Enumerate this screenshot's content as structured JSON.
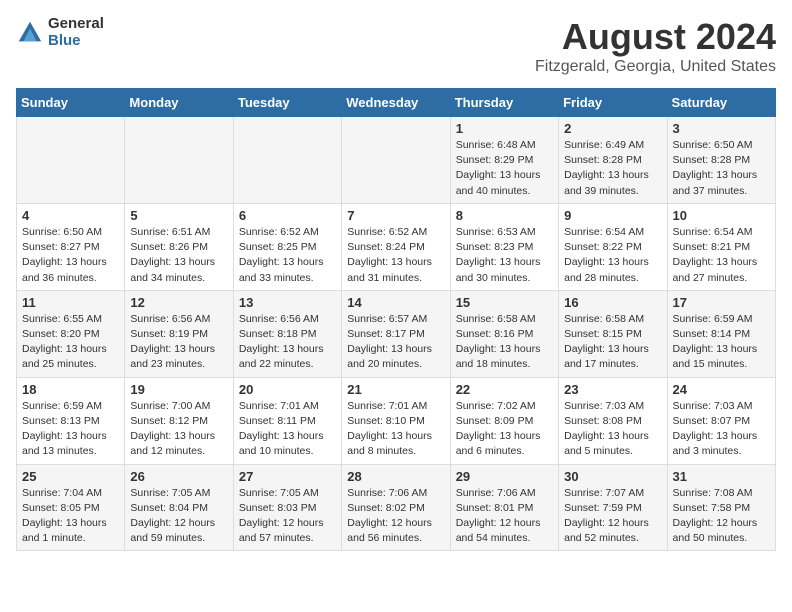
{
  "logo": {
    "general": "General",
    "blue": "Blue"
  },
  "title": "August 2024",
  "subtitle": "Fitzgerald, Georgia, United States",
  "days_of_week": [
    "Sunday",
    "Monday",
    "Tuesday",
    "Wednesday",
    "Thursday",
    "Friday",
    "Saturday"
  ],
  "weeks": [
    [
      {
        "day": "",
        "sunrise": "",
        "sunset": "",
        "daylight": ""
      },
      {
        "day": "",
        "sunrise": "",
        "sunset": "",
        "daylight": ""
      },
      {
        "day": "",
        "sunrise": "",
        "sunset": "",
        "daylight": ""
      },
      {
        "day": "",
        "sunrise": "",
        "sunset": "",
        "daylight": ""
      },
      {
        "day": "1",
        "sunrise": "Sunrise: 6:48 AM",
        "sunset": "Sunset: 8:29 PM",
        "daylight": "Daylight: 13 hours and 40 minutes."
      },
      {
        "day": "2",
        "sunrise": "Sunrise: 6:49 AM",
        "sunset": "Sunset: 8:28 PM",
        "daylight": "Daylight: 13 hours and 39 minutes."
      },
      {
        "day": "3",
        "sunrise": "Sunrise: 6:50 AM",
        "sunset": "Sunset: 8:28 PM",
        "daylight": "Daylight: 13 hours and 37 minutes."
      }
    ],
    [
      {
        "day": "4",
        "sunrise": "Sunrise: 6:50 AM",
        "sunset": "Sunset: 8:27 PM",
        "daylight": "Daylight: 13 hours and 36 minutes."
      },
      {
        "day": "5",
        "sunrise": "Sunrise: 6:51 AM",
        "sunset": "Sunset: 8:26 PM",
        "daylight": "Daylight: 13 hours and 34 minutes."
      },
      {
        "day": "6",
        "sunrise": "Sunrise: 6:52 AM",
        "sunset": "Sunset: 8:25 PM",
        "daylight": "Daylight: 13 hours and 33 minutes."
      },
      {
        "day": "7",
        "sunrise": "Sunrise: 6:52 AM",
        "sunset": "Sunset: 8:24 PM",
        "daylight": "Daylight: 13 hours and 31 minutes."
      },
      {
        "day": "8",
        "sunrise": "Sunrise: 6:53 AM",
        "sunset": "Sunset: 8:23 PM",
        "daylight": "Daylight: 13 hours and 30 minutes."
      },
      {
        "day": "9",
        "sunrise": "Sunrise: 6:54 AM",
        "sunset": "Sunset: 8:22 PM",
        "daylight": "Daylight: 13 hours and 28 minutes."
      },
      {
        "day": "10",
        "sunrise": "Sunrise: 6:54 AM",
        "sunset": "Sunset: 8:21 PM",
        "daylight": "Daylight: 13 hours and 27 minutes."
      }
    ],
    [
      {
        "day": "11",
        "sunrise": "Sunrise: 6:55 AM",
        "sunset": "Sunset: 8:20 PM",
        "daylight": "Daylight: 13 hours and 25 minutes."
      },
      {
        "day": "12",
        "sunrise": "Sunrise: 6:56 AM",
        "sunset": "Sunset: 8:19 PM",
        "daylight": "Daylight: 13 hours and 23 minutes."
      },
      {
        "day": "13",
        "sunrise": "Sunrise: 6:56 AM",
        "sunset": "Sunset: 8:18 PM",
        "daylight": "Daylight: 13 hours and 22 minutes."
      },
      {
        "day": "14",
        "sunrise": "Sunrise: 6:57 AM",
        "sunset": "Sunset: 8:17 PM",
        "daylight": "Daylight: 13 hours and 20 minutes."
      },
      {
        "day": "15",
        "sunrise": "Sunrise: 6:58 AM",
        "sunset": "Sunset: 8:16 PM",
        "daylight": "Daylight: 13 hours and 18 minutes."
      },
      {
        "day": "16",
        "sunrise": "Sunrise: 6:58 AM",
        "sunset": "Sunset: 8:15 PM",
        "daylight": "Daylight: 13 hours and 17 minutes."
      },
      {
        "day": "17",
        "sunrise": "Sunrise: 6:59 AM",
        "sunset": "Sunset: 8:14 PM",
        "daylight": "Daylight: 13 hours and 15 minutes."
      }
    ],
    [
      {
        "day": "18",
        "sunrise": "Sunrise: 6:59 AM",
        "sunset": "Sunset: 8:13 PM",
        "daylight": "Daylight: 13 hours and 13 minutes."
      },
      {
        "day": "19",
        "sunrise": "Sunrise: 7:00 AM",
        "sunset": "Sunset: 8:12 PM",
        "daylight": "Daylight: 13 hours and 12 minutes."
      },
      {
        "day": "20",
        "sunrise": "Sunrise: 7:01 AM",
        "sunset": "Sunset: 8:11 PM",
        "daylight": "Daylight: 13 hours and 10 minutes."
      },
      {
        "day": "21",
        "sunrise": "Sunrise: 7:01 AM",
        "sunset": "Sunset: 8:10 PM",
        "daylight": "Daylight: 13 hours and 8 minutes."
      },
      {
        "day": "22",
        "sunrise": "Sunrise: 7:02 AM",
        "sunset": "Sunset: 8:09 PM",
        "daylight": "Daylight: 13 hours and 6 minutes."
      },
      {
        "day": "23",
        "sunrise": "Sunrise: 7:03 AM",
        "sunset": "Sunset: 8:08 PM",
        "daylight": "Daylight: 13 hours and 5 minutes."
      },
      {
        "day": "24",
        "sunrise": "Sunrise: 7:03 AM",
        "sunset": "Sunset: 8:07 PM",
        "daylight": "Daylight: 13 hours and 3 minutes."
      }
    ],
    [
      {
        "day": "25",
        "sunrise": "Sunrise: 7:04 AM",
        "sunset": "Sunset: 8:05 PM",
        "daylight": "Daylight: 13 hours and 1 minute."
      },
      {
        "day": "26",
        "sunrise": "Sunrise: 7:05 AM",
        "sunset": "Sunset: 8:04 PM",
        "daylight": "Daylight: 12 hours and 59 minutes."
      },
      {
        "day": "27",
        "sunrise": "Sunrise: 7:05 AM",
        "sunset": "Sunset: 8:03 PM",
        "daylight": "Daylight: 12 hours and 57 minutes."
      },
      {
        "day": "28",
        "sunrise": "Sunrise: 7:06 AM",
        "sunset": "Sunset: 8:02 PM",
        "daylight": "Daylight: 12 hours and 56 minutes."
      },
      {
        "day": "29",
        "sunrise": "Sunrise: 7:06 AM",
        "sunset": "Sunset: 8:01 PM",
        "daylight": "Daylight: 12 hours and 54 minutes."
      },
      {
        "day": "30",
        "sunrise": "Sunrise: 7:07 AM",
        "sunset": "Sunset: 7:59 PM",
        "daylight": "Daylight: 12 hours and 52 minutes."
      },
      {
        "day": "31",
        "sunrise": "Sunrise: 7:08 AM",
        "sunset": "Sunset: 7:58 PM",
        "daylight": "Daylight: 12 hours and 50 minutes."
      }
    ]
  ]
}
